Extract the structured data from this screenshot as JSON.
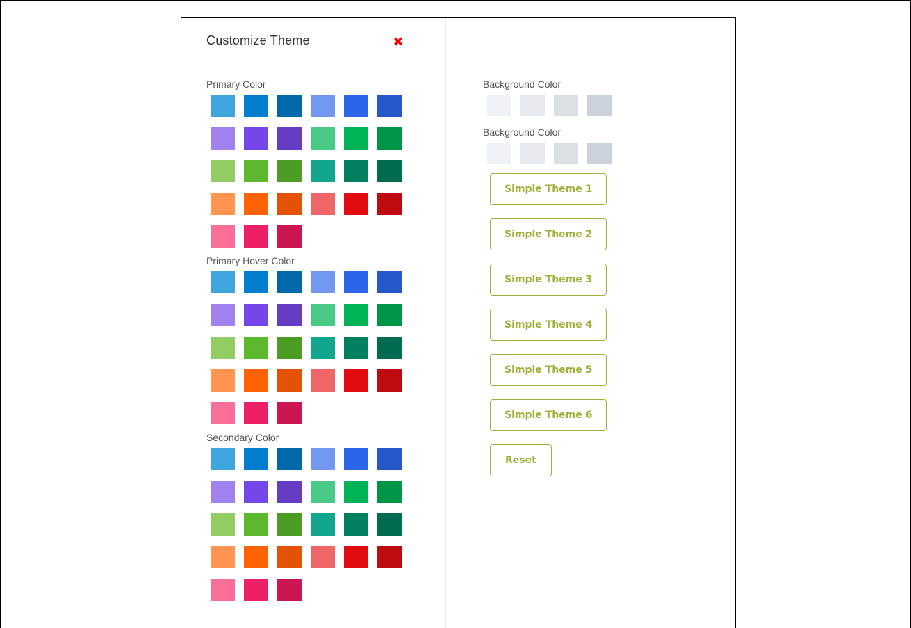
{
  "panel": {
    "title": "Customize Theme",
    "close_icon": "close-icon",
    "close_glyph": "✖"
  },
  "palette": [
    "#3ea5dd",
    "#007ecd",
    "#0068ab",
    "#7197ee",
    "#2b66e8",
    "#2458c8",
    "#a082ee",
    "#7546e8",
    "#653cc3",
    "#48ca86",
    "#00b457",
    "#00964a",
    "#91cd60",
    "#5cb82d",
    "#4d9c26",
    "#13a68e",
    "#00805f",
    "#006c50",
    "#ff9551",
    "#ff6200",
    "#e45206",
    "#ee6665",
    "#df0b0f",
    "#bd0b10",
    "#f96f97",
    "#ee1f68",
    "#cb1652"
  ],
  "sections": [
    {
      "label": "Primary Color"
    },
    {
      "label": "Primary Hover Color"
    },
    {
      "label": "Secondary Color"
    }
  ],
  "background_sections": [
    {
      "label": "Background Color",
      "colors": [
        "#f0f3f6",
        "#e6eaee",
        "#dbe0e5",
        "#cbd2d9"
      ]
    },
    {
      "label": "Background Color",
      "colors": [
        "#f0f3f6",
        "#e6eaee",
        "#dbe0e5",
        "#cbd2d9"
      ]
    }
  ],
  "theme_buttons": [
    "Simple Theme 1",
    "Simple Theme 2",
    "Simple Theme 3",
    "Simple Theme 4",
    "Simple Theme 5",
    "Simple Theme 6"
  ],
  "reset_label": "Reset",
  "colors": {
    "accent": "#a0b03a",
    "close": "#ff0000"
  }
}
